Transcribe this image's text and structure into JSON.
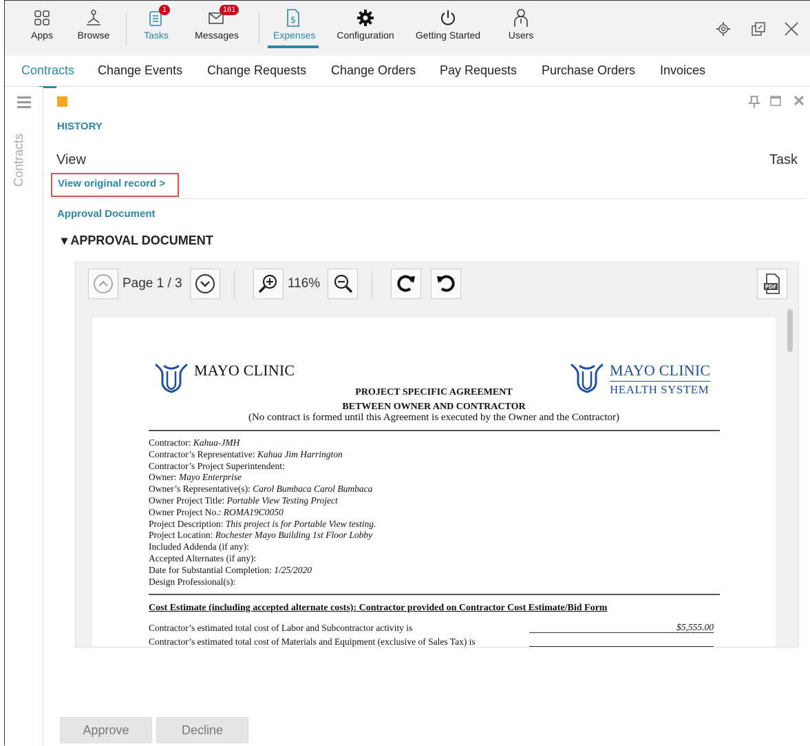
{
  "toolbar": {
    "items": [
      {
        "label": "Apps",
        "icon": "apps-grid-icon"
      },
      {
        "label": "Browse",
        "icon": "browse-network-icon"
      },
      {
        "label": "Tasks",
        "icon": "tasks-clipboard-icon",
        "badge": "1"
      },
      {
        "label": "Messages",
        "icon": "messages-envelope-icon",
        "badge": "161"
      },
      {
        "label": "Expenses",
        "icon": "expenses-dollar-icon",
        "active": true
      },
      {
        "label": "Configuration",
        "icon": "configuration-gear-icon"
      },
      {
        "label": "Getting Started",
        "icon": "power-icon"
      },
      {
        "label": "Users",
        "icon": "users-icon"
      }
    ],
    "window_controls": [
      "settings-icon",
      "popout-icon",
      "close-icon"
    ]
  },
  "tabs": [
    "Contracts",
    "Change Events",
    "Change Requests",
    "Change Orders",
    "Pay Requests",
    "Purchase Orders",
    "Invoices"
  ],
  "active_tab": "Contracts",
  "rail": {
    "label": "Contracts"
  },
  "content": {
    "history": "HISTORY",
    "view": "View",
    "task": "Task",
    "view_original": "View original record >",
    "approval_link": "Approval Document",
    "approval_header": "▾ APPROVAL DOCUMENT"
  },
  "viewer": {
    "page_label": "Page 1 / 3",
    "zoom": "116%",
    "pdf_label": "PDF"
  },
  "document": {
    "logo_left": "MAYO CLINIC",
    "logo_right_1": "MAYO CLINIC",
    "logo_right_2": "HEALTH SYSTEM",
    "title_1": "PROJECT SPECIFIC AGREEMENT",
    "title_2": "BETWEEN OWNER AND CONTRACTOR",
    "subtitle": "(No contract is formed until this Agreement is executed by the Owner and the Contractor)",
    "fields": [
      {
        "label": "Contractor:",
        "value": "Kahua-JMH"
      },
      {
        "label": "Contractor’s Representative:",
        "value": "Kahua Jim Harrington"
      },
      {
        "label": "Contractor’s Project Superintendent:",
        "value": ""
      },
      {
        "label": "Owner:",
        "value": "Mayo Enterprise"
      },
      {
        "label": "Owner’s Representative(s):",
        "value": "Carol Bumbaca Carol Bumbaca"
      },
      {
        "label": "Owner Project Title:",
        "value": "Portable View Testing Project"
      },
      {
        "label": "Owner Project No.:",
        "value": "ROMA19C0050"
      },
      {
        "label": "Project Description:",
        "value": "This project is for Portable View testing."
      },
      {
        "label": "Project Location:",
        "value": "Rochester Mayo Building 1st Floor Lobby"
      },
      {
        "label": "Included Addenda (if any):",
        "value": ""
      },
      {
        "label": "Accepted Alternates (if any):",
        "value": ""
      },
      {
        "label": "Date for Substantial Completion:",
        "value": "1/25/2020"
      },
      {
        "label": "Design Professional(s):",
        "value": ""
      }
    ],
    "cost_heading": "Cost Estimate (including accepted alternate costs): Contractor provided on Contractor Cost Estimate/Bid Form",
    "cost_rows": [
      {
        "text": "Contractor’s estimated total cost of Labor and Subcontractor activity is",
        "value": "$5,555.00"
      },
      {
        "text": "Contractor’s estimated total cost of Materials and Equipment (exclusive of Sales Tax) is",
        "value": ""
      }
    ]
  },
  "buttons": {
    "approve": "Approve",
    "decline": "Decline"
  }
}
